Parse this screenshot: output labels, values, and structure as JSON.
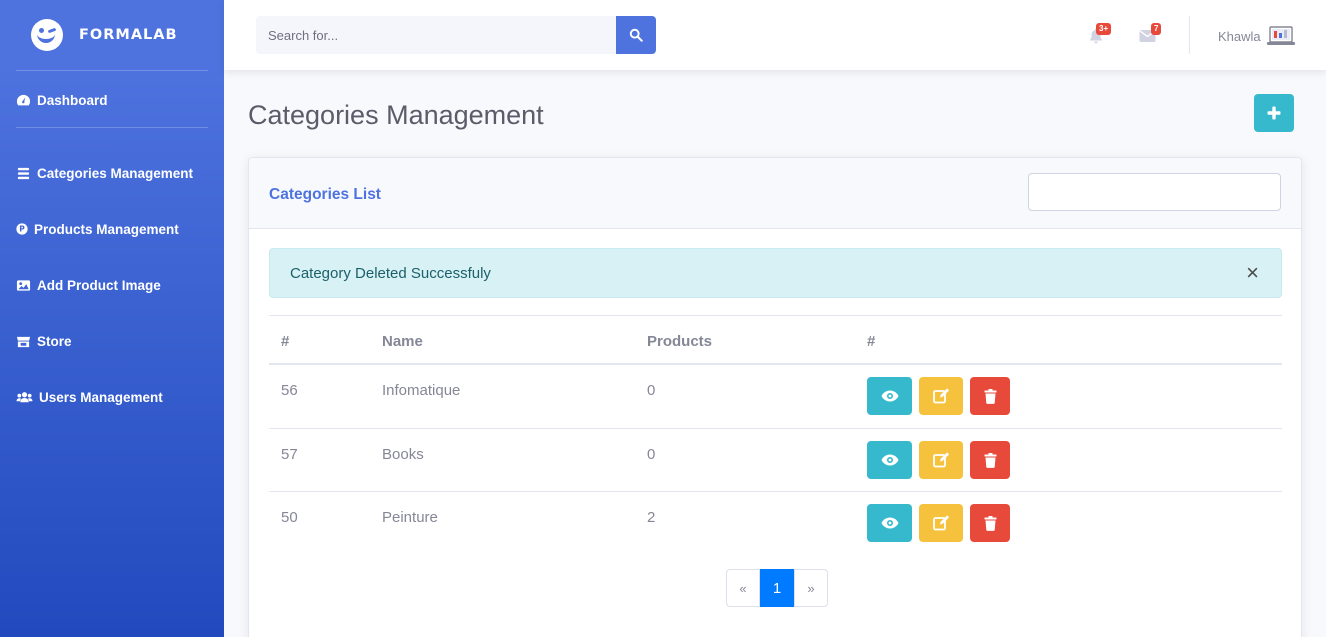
{
  "brand": {
    "name": "FORMALAB"
  },
  "sidebar": {
    "items": [
      {
        "label": "Dashboard",
        "icon": "tachometer-icon"
      },
      {
        "label": "Categories Management",
        "icon": "bars-icon"
      },
      {
        "label": "Products Management",
        "icon": "product-p-icon"
      },
      {
        "label": "Add Product Image",
        "icon": "image-icon"
      },
      {
        "label": "Store",
        "icon": "store-icon"
      },
      {
        "label": "Users Management",
        "icon": "users-icon"
      }
    ]
  },
  "topbar": {
    "search_placeholder": "Search for...",
    "alerts_badge": "3+",
    "messages_badge": "7",
    "user_name": "Khawla"
  },
  "page": {
    "title": "Categories Management"
  },
  "card": {
    "title": "Categories List",
    "alert_message": "Category Deleted Successfuly",
    "alert_close": "×"
  },
  "table": {
    "headers": [
      "#",
      "Name",
      "Products",
      "#"
    ],
    "rows": [
      {
        "id": "56",
        "name": "Infomatique",
        "products": "0"
      },
      {
        "id": "57",
        "name": "Books",
        "products": "0"
      },
      {
        "id": "50",
        "name": "Peinture",
        "products": "2"
      }
    ]
  },
  "pagination": {
    "prev": "«",
    "current": "1",
    "next": "»"
  },
  "colors": {
    "primary": "#4e73df",
    "info": "#36b9cc",
    "warning": "#f6c23e",
    "danger": "#e74a3b",
    "page_active": "#007bff"
  }
}
